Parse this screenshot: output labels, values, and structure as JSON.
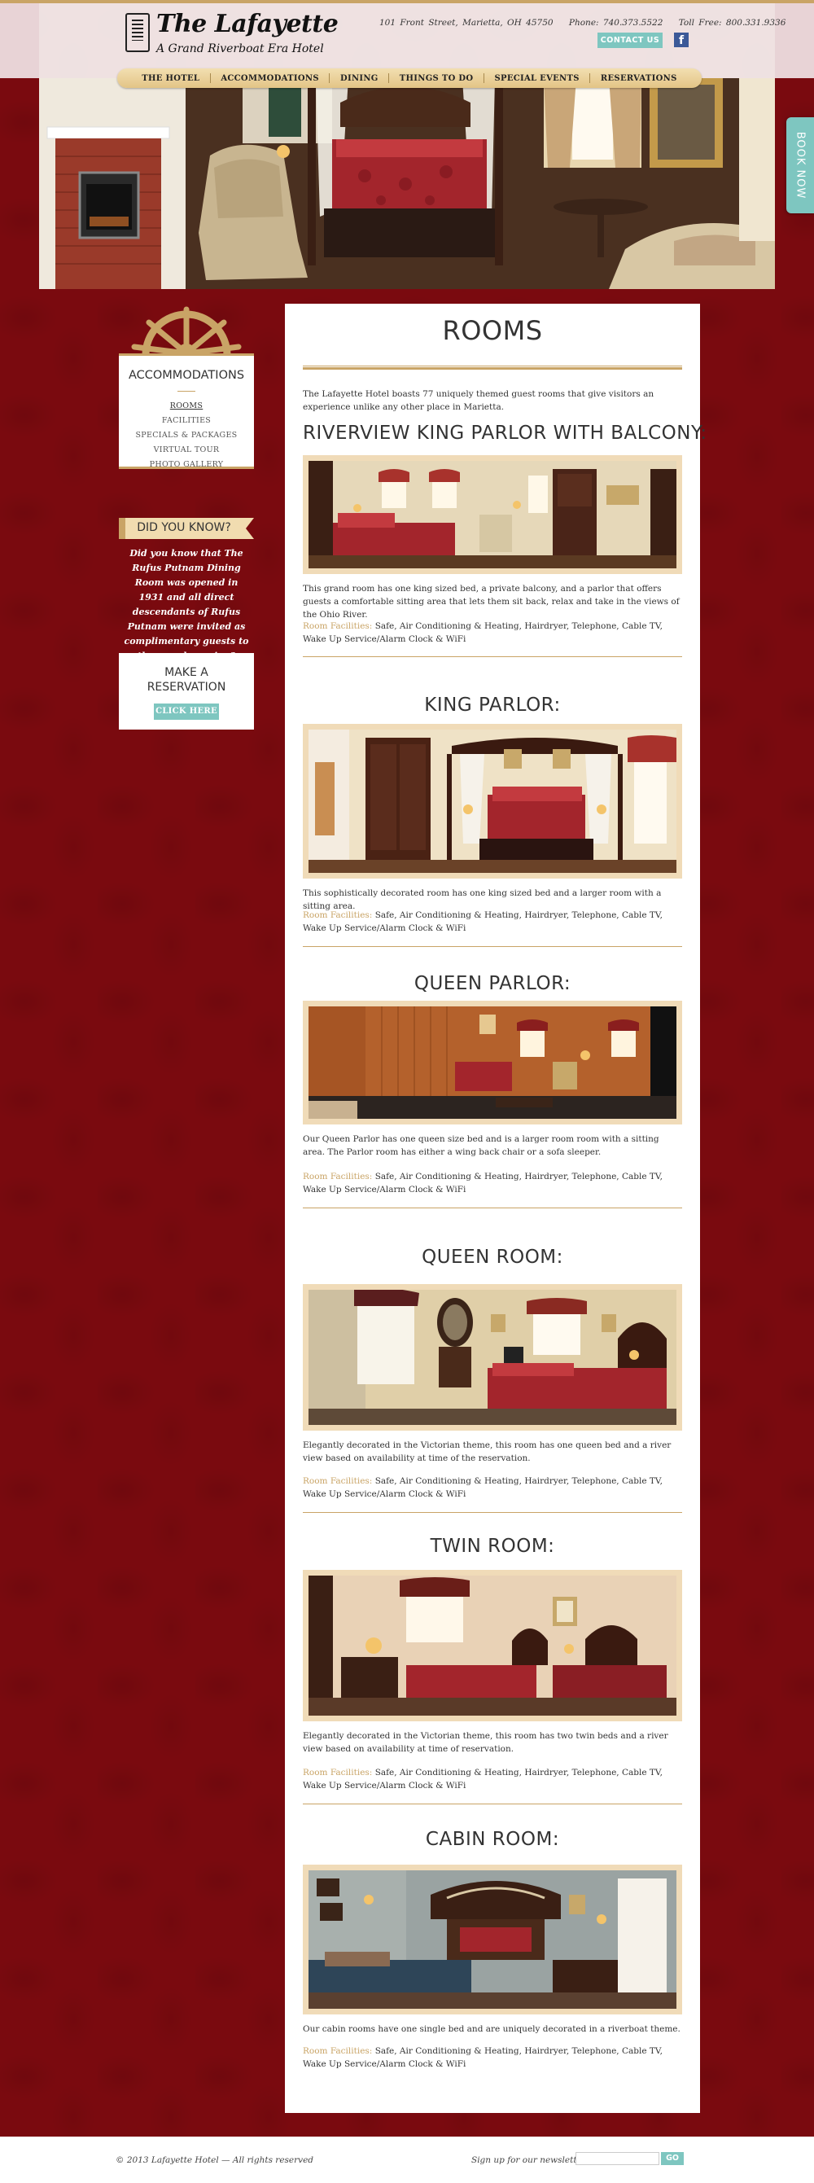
{
  "header": {
    "logo_name": "The Lafayette",
    "logo_tagline": "A Grand Riverboat Era Hotel",
    "address": "101 Front Street, Marietta, OH 45750",
    "phone": "Phone: 740.373.5522",
    "tollfree": "Toll Free: 800.331.9336",
    "contact_label": "CONTACT US",
    "facebook_glyph": "f",
    "facebook_icon": "facebook-icon"
  },
  "nav": [
    "THE HOTEL",
    "ACCOMMODATIONS",
    "DINING",
    "THINGS TO DO",
    "SPECIAL EVENTS",
    "RESERVATIONS"
  ],
  "book_now": "BOOK NOW",
  "sidebar": {
    "accom_title": "ACCOMMODATIONS",
    "links": [
      "ROOMS",
      "FACILITIES",
      "SPECIALS & PACKAGES",
      "VIRTUAL TOUR",
      "PHOTO GALLERY"
    ],
    "didyou_title": "DID YOU KNOW?",
    "didyou_text": "Did you know that The Rufus Putnam Dining Room was opened in 1931 and all direct descendants of Rufus Putnam were invited as complimentary guests to the grand opening?",
    "reserve_title_1": "MAKE A",
    "reserve_title_2": "RESERVATION",
    "reserve_btn": "CLICK HERE"
  },
  "main": {
    "title": "ROOMS",
    "intro": "The Lafayette Hotel boasts 77 uniquely themed guest rooms that give visitors an experience unlike any other place in Marietta.",
    "facilities_label": "Room Facilities:",
    "rooms": [
      {
        "title": "RIVERVIEW KING PARLOR WITH BALCONY:",
        "desc": "This grand room has one king sized bed, a private balcony, and a parlor that offers guests a comfortable sitting area that lets them sit back, relax and take in the views of the Ohio River.",
        "facilities": "Safe, Air Conditioning & Heating, Hairdryer, Telephone, Cable TV, Wake Up Service/Alarm Clock & WiFi"
      },
      {
        "title": "KING PARLOR:",
        "desc": "This sophistically decorated room has one king sized bed and a larger room with a sitting area.",
        "facilities": "Safe, Air Conditioning & Heating, Hairdryer, Telephone, Cable TV, Wake Up Service/Alarm Clock & WiFi"
      },
      {
        "title": "QUEEN PARLOR:",
        "desc": "Our Queen Parlor has one queen size bed and is a larger room room with a sitting area.  The Parlor room has either a wing back chair or a sofa sleeper.",
        "facilities": "Safe, Air Conditioning & Heating, Hairdryer, Telephone, Cable TV, Wake Up Service/Alarm Clock & WiFi"
      },
      {
        "title": "QUEEN ROOM:",
        "desc": "Elegantly decorated in the Victorian theme, this room has one queen bed and a river view based on availability at time of the reservation.",
        "facilities": "Safe, Air Conditioning & Heating, Hairdryer, Telephone, Cable TV, Wake Up Service/Alarm Clock & WiFi"
      },
      {
        "title": "TWIN ROOM:",
        "desc": "Elegantly decorated in the Victorian theme, this room has two twin beds and a river view based on availability at time of reservation.",
        "facilities": "Safe, Air Conditioning & Heating, Hairdryer, Telephone, Cable TV, Wake Up Service/Alarm Clock & WiFi"
      },
      {
        "title": "CABIN ROOM:",
        "desc": "Our cabin rooms have one single bed and are uniquely decorated in a riverboat theme.",
        "facilities": "Safe, Air Conditioning & Heating, Hairdryer, Telephone, Cable TV, Wake Up Service/Alarm Clock & WiFi"
      }
    ]
  },
  "footer": {
    "copyright": "© 2013 Lafayette Hotel — All rights reserved",
    "newsletter_label": "Sign up for our newsletter:",
    "newsletter_placeholder": "",
    "go": "GO"
  },
  "colors": {
    "brand_red": "#7a0a0f",
    "gold": "#c9a466",
    "teal": "#7ec6c0"
  }
}
